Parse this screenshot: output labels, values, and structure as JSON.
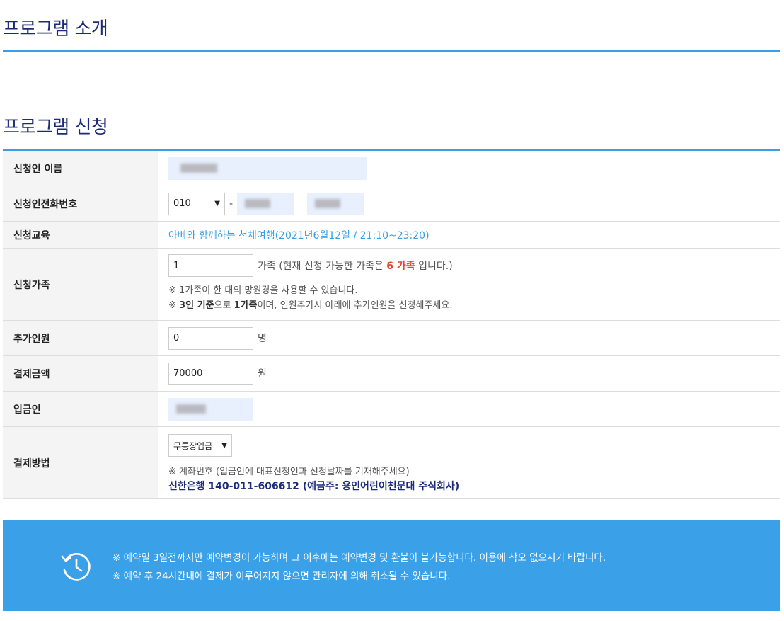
{
  "sections": {
    "intro_title": "프로그램 소개",
    "apply_title": "프로그램 신청"
  },
  "form": {
    "name": {
      "label": "신청인 이름"
    },
    "phone": {
      "label": "신청인전화번호",
      "prefix": "010",
      "separator": "-"
    },
    "course": {
      "label": "신청교육",
      "value": "아빠와 함께하는 천체여행(2021년6월12일 / 21:10~23:20)"
    },
    "family": {
      "label": "신청가족",
      "value": "1",
      "unit": "가족",
      "avail_pre": "(현재 신청 가능한 가족은 ",
      "avail_count": "6 가족",
      "avail_post": " 입니다.)",
      "note1": "※ 1가족이 한 대의 망원경을 사용할 수 있습니다.",
      "note2_mark": "※ ",
      "note2_bold1": "3인 기준",
      "note2_mid": "으로 ",
      "note2_bold2": "1가족",
      "note2_post": "이며, 인원추가시 아래에 추가인원을 신청해주세요."
    },
    "extra": {
      "label": "추가인원",
      "value": "0",
      "unit": "명"
    },
    "amount": {
      "label": "결제금액",
      "value": "70000",
      "unit": "원"
    },
    "depositor": {
      "label": "입금인"
    },
    "payment": {
      "label": "결제방법",
      "selected": "무통장입금",
      "note": "※ 계좌번호 (입금인에 대표신청인과 신청날짜를 기재해주세요)",
      "bank": "신한은행 140-011-606612 (예금주: 용인어린이천문대 주식회사)"
    }
  },
  "notice": {
    "icon": "history-clock-icon",
    "line1": "※ 예약일 3일전까지만 예약변경이 가능하며 그 이후에는 예약변경 및 환불이 불가능합니다. 이용에 착오 없으시기 바랍니다.",
    "line2": "※ 예약 후 24시간내에 결제가 이루어지지 않으면 관리자에 의해 취소될 수 있습니다."
  },
  "colors": {
    "accent": "#3a9ee4",
    "title": "#1c2a7a",
    "highlight": "#e0462b",
    "notice_bg": "#3aa1e8"
  }
}
